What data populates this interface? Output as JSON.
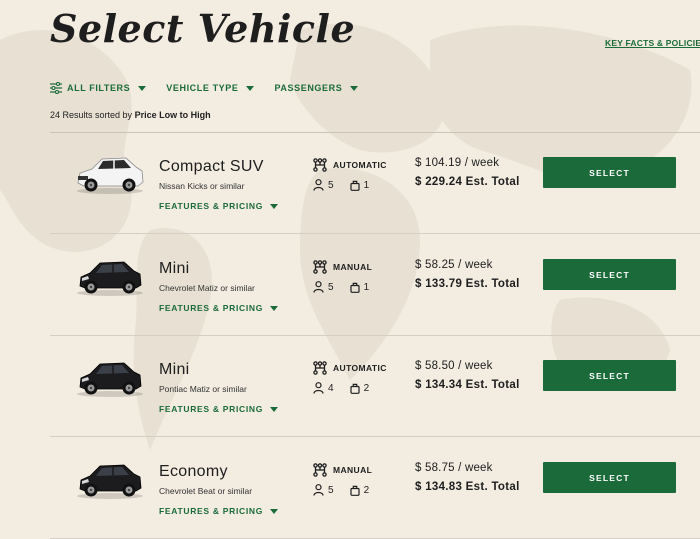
{
  "page": {
    "title": "Select Vehicle",
    "key_facts_link": "KEY FACTS & POLICIES"
  },
  "filters": {
    "all_filters": "ALL FILTERS",
    "vehicle_type": "VEHICLE TYPE",
    "passengers": "PASSENGERS"
  },
  "results": {
    "count_text": "24 Results sorted by",
    "sort_label": "Price Low to High"
  },
  "vehicles": [
    {
      "name": "Compact SUV",
      "model": "Nissan Kicks or similar",
      "features_label": "FEATURES & PRICING",
      "transmission": "AUTOMATIC",
      "passengers": "5",
      "bags": "1",
      "price_week": "$ 104.19 / week",
      "price_total": "$ 229.24 Est. Total",
      "select_label": "SELECT",
      "color": "#f4f4f4",
      "body": "suv"
    },
    {
      "name": "Mini",
      "model": "Chevrolet Matiz or similar",
      "features_label": "FEATURES & PRICING",
      "transmission": "MANUAL",
      "passengers": "5",
      "bags": "1",
      "price_week": "$ 58.25 / week",
      "price_total": "$ 133.79 Est. Total",
      "select_label": "SELECT",
      "color": "#1c1c1e",
      "body": "hatch"
    },
    {
      "name": "Mini",
      "model": "Pontiac Matiz or similar",
      "features_label": "FEATURES & PRICING",
      "transmission": "AUTOMATIC",
      "passengers": "4",
      "bags": "2",
      "price_week": "$ 58.50 / week",
      "price_total": "$ 134.34 Est. Total",
      "select_label": "SELECT",
      "color": "#1c1c1e",
      "body": "hatch"
    },
    {
      "name": "Economy",
      "model": "Chevrolet Beat or similar",
      "features_label": "FEATURES & PRICING",
      "transmission": "MANUAL",
      "passengers": "5",
      "bags": "2",
      "price_week": "$ 58.75 / week",
      "price_total": "$ 134.83 Est. Total",
      "select_label": "SELECT",
      "color": "#1c1c1e",
      "body": "hatch"
    }
  ],
  "colors": {
    "accent": "#1b6b3a",
    "background": "#f2ece1",
    "text": "#1e1e1e"
  },
  "icons": {
    "filters": "sliders-icon",
    "transmission": "gear-shift-icon",
    "passengers": "person-icon",
    "bags": "bag-icon"
  }
}
